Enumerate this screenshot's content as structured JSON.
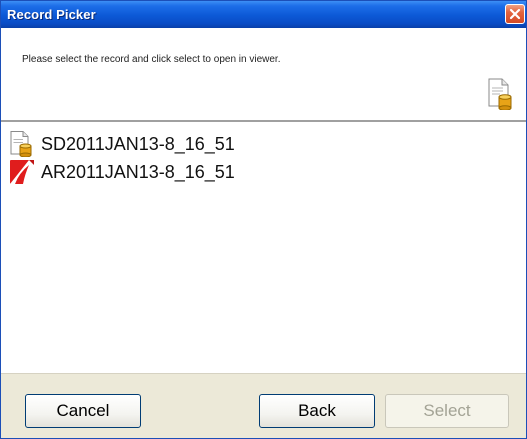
{
  "window": {
    "title": "Record Picker",
    "close_icon": "close-icon"
  },
  "header": {
    "instruction": "Please select the record and click select to open in viewer.",
    "icon": "document-database-icon"
  },
  "records": [
    {
      "label": "SD2011JAN13-8_16_51",
      "icon": "document-database-icon"
    },
    {
      "label": "AR2011JAN13-8_16_51",
      "icon": "pdf-document-icon"
    }
  ],
  "footer": {
    "cancel_label": "Cancel",
    "back_label": "Back",
    "select_label": "Select"
  },
  "colors": {
    "titlebar": "#0c58d6",
    "close_button": "#d44a25",
    "footer_bg": "#ece9d8",
    "pdf_red": "#e01d1d",
    "database_gold": "#e8a317",
    "disabled_text": "#a3a395"
  }
}
